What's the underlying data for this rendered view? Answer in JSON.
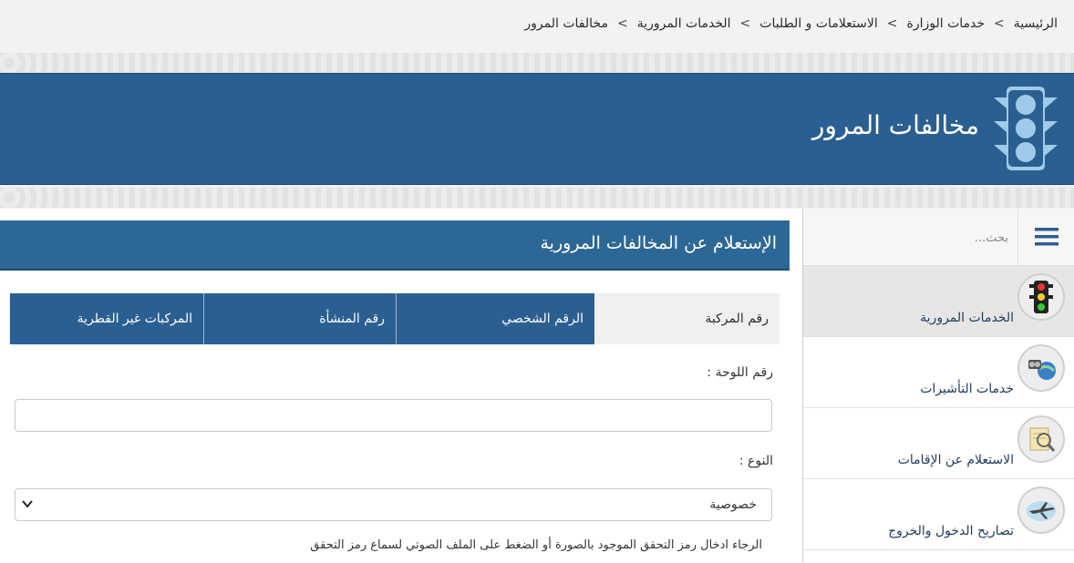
{
  "breadcrumb": {
    "items": [
      "الرئيسية",
      "خدمات الوزارة",
      "الاستعلامات و الطلبات",
      "الخدمات المرورية",
      "مخالفات المرور"
    ],
    "separator": ">"
  },
  "banner": {
    "title": "مخالفات المرور",
    "icon": "traffic-light-icon",
    "bg_color": "#2b5f91"
  },
  "sidebar": {
    "search_placeholder": "بحث...",
    "menu_icon": "hamburger-menu-icon",
    "items": [
      {
        "label": "الخدمات المرورية",
        "icon": "traffic-light-icon"
      },
      {
        "label": "خدمات التأشيرات",
        "icon": "visa-services-icon"
      },
      {
        "label": "الاستعلام عن الإقامات",
        "icon": "residency-inquiry-icon"
      },
      {
        "label": "تصاريح الدخول والخروج",
        "icon": "airplane-icon"
      }
    ]
  },
  "main": {
    "section_title": "الإستعلام عن المخالفات المرورية",
    "tabs": [
      {
        "label": "رقم المركبة"
      },
      {
        "label": "الرقم الشخصي"
      },
      {
        "label": "رقم المنشأة"
      },
      {
        "label": "المركبات غير القطرية"
      }
    ],
    "plate_label": "رقم اللوحة :",
    "plate_value": "",
    "type_label": "النوع :",
    "type_value": "خصوصية",
    "captcha_note": "الرجاء ادخال رمز التحقق الموجود بالصورة أو الضغط على الملف الصوتي لسماع رمز التحقق"
  }
}
